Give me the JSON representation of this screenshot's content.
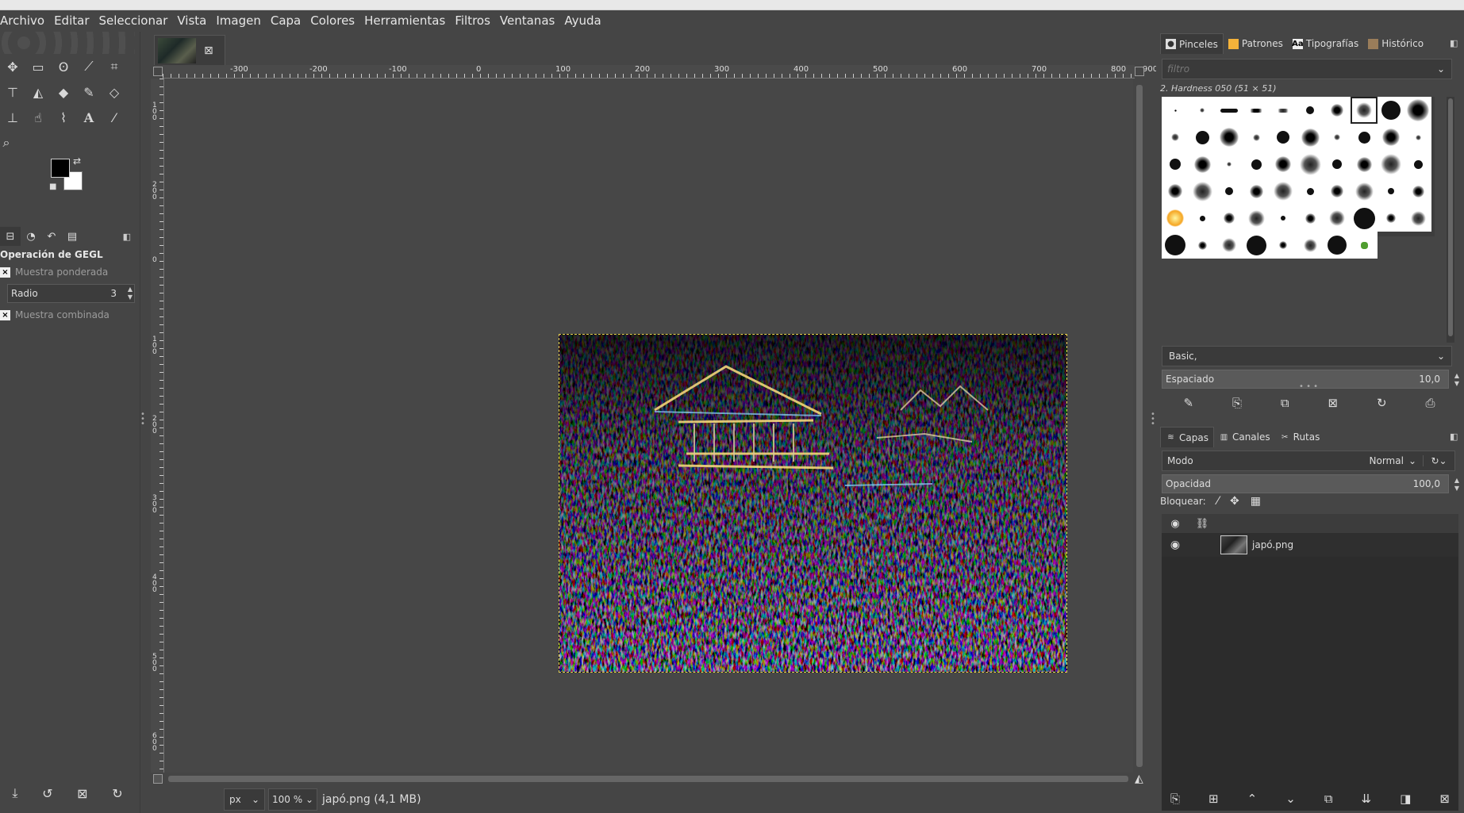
{
  "menu": [
    "Archivo",
    "Editar",
    "Seleccionar",
    "Vista",
    "Imagen",
    "Capa",
    "Colores",
    "Herramientas",
    "Filtros",
    "Ventanas",
    "Ayuda"
  ],
  "tool_options": {
    "title": "Operación de GEGL",
    "weighted_sample": "Muestra ponderada",
    "radius_label": "Radio",
    "radius_value": "3",
    "combined_sample": "Muestra combinada"
  },
  "rulers": {
    "h": [
      "-300",
      "-200",
      "-100",
      "0",
      "100",
      "200",
      "300",
      "400",
      "500",
      "600",
      "700",
      "800",
      "900"
    ],
    "v": [
      "100",
      "200",
      "0",
      "100",
      "200",
      "300",
      "400",
      "500",
      "600"
    ]
  },
  "status": {
    "unit": "px",
    "zoom": "100 %",
    "file_info": "japó.png (4,1 MB)"
  },
  "dock_top": {
    "tabs": [
      "Pinceles",
      "Patrones",
      "Tipografías",
      "Histórico"
    ],
    "filter_placeholder": "filtro",
    "brush_name": "2. Hardness 050 (51 × 51)",
    "tag": "Basic,",
    "spacing_label": "Espaciado",
    "spacing_value": "10,0"
  },
  "dock_bottom": {
    "tabs": [
      "Capas",
      "Canales",
      "Rutas"
    ],
    "mode_label": "Modo",
    "mode_value": "Normal",
    "opacity_label": "Opacidad",
    "opacity_value": "100,0",
    "lock_label": "Bloquear:",
    "layer_name": "japó.png"
  },
  "colors": {
    "foreground": "#000000",
    "background": "#ffffff",
    "selection": "#e8d44b"
  }
}
